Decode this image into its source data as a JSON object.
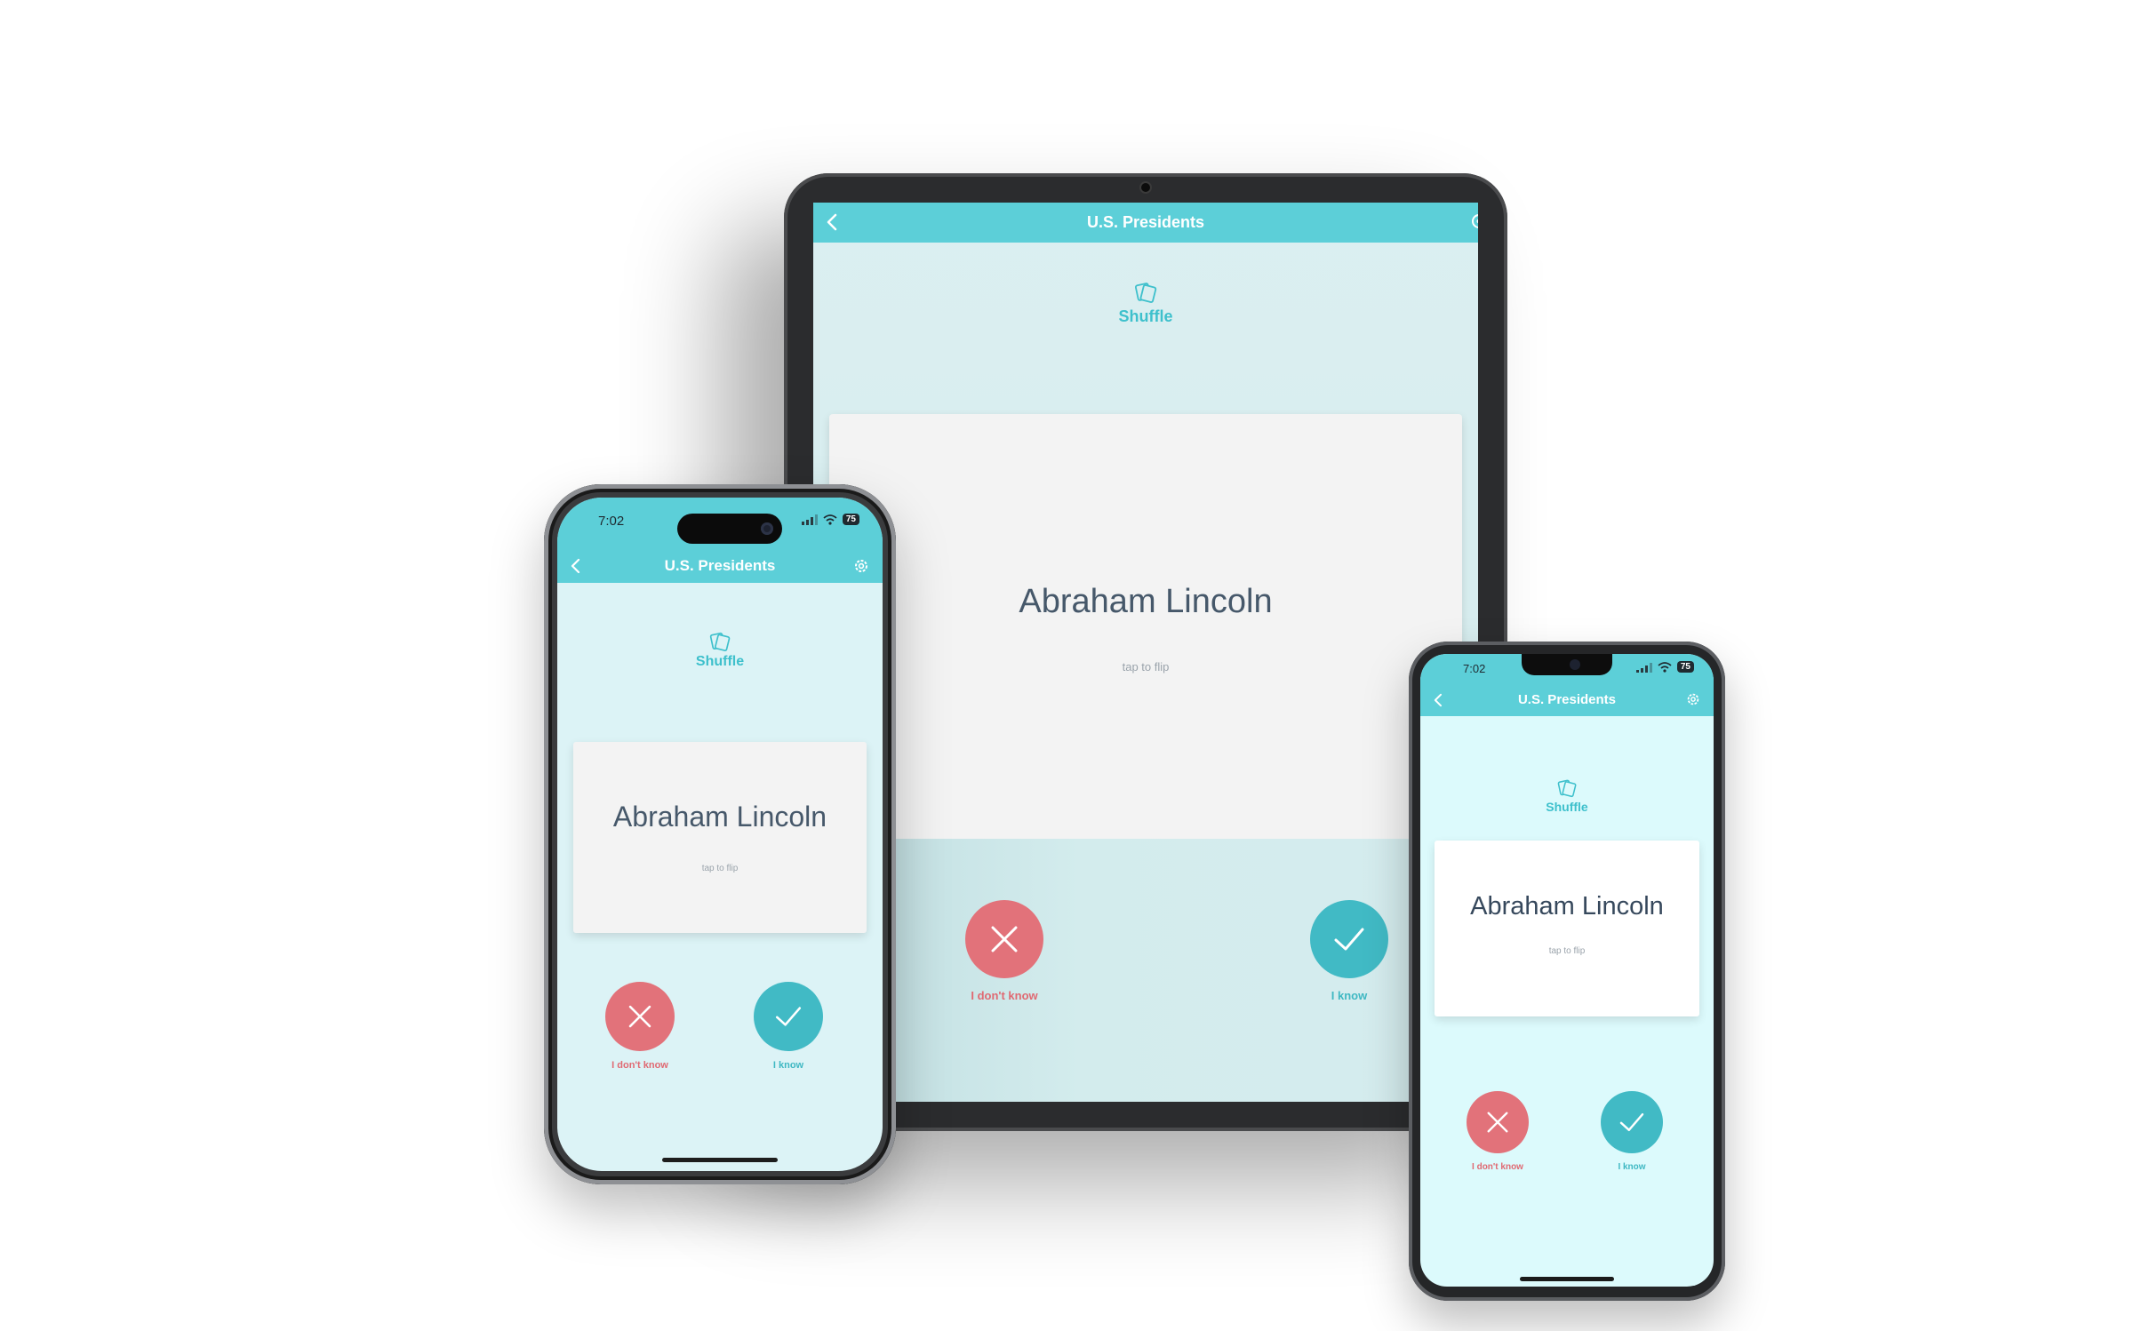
{
  "app": {
    "title": "U.S. Presidents",
    "shuffle_label": "Shuffle",
    "card_term": "Abraham Lincoln",
    "card_hint": "tap to flip",
    "dont_know_label": "I don't know",
    "know_label": "I know"
  },
  "status_bar": {
    "time": "7:02",
    "battery": "75"
  },
  "icons": {
    "back": "chevron-left-icon",
    "settings": "gear-icon",
    "shuffle": "cards-icon",
    "dont_know": "x-icon",
    "know": "check-icon"
  },
  "colors": {
    "accent": "#5ccfd8",
    "know": "#41bac5",
    "dont_know": "#e2727a",
    "text": "#46586a"
  }
}
